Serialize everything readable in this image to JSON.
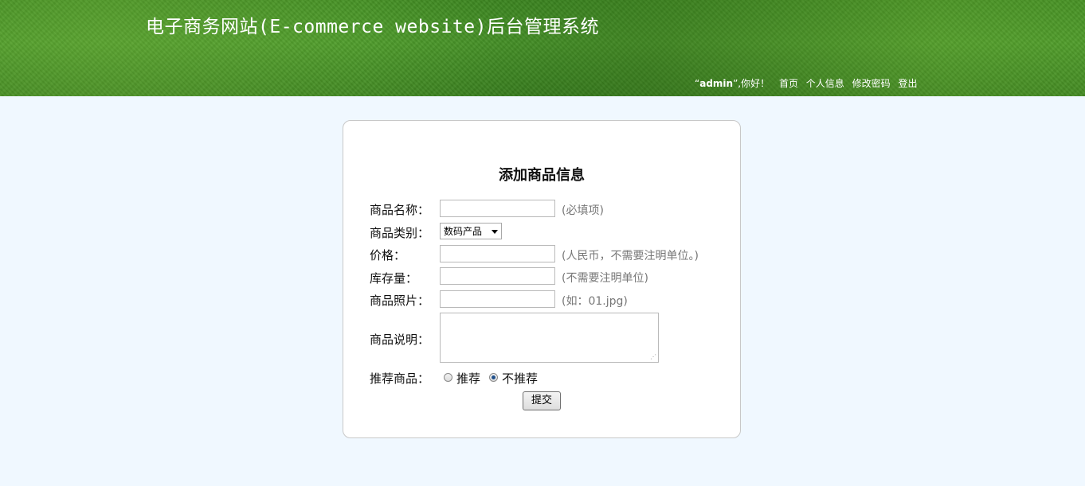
{
  "header": {
    "title": "电子商务网站(E-commerce website)后台管理系统",
    "user_prefix": "“",
    "user": "admin",
    "user_suffix": "”,你好！",
    "links": [
      "首页",
      "个人信息",
      "修改密码",
      "登出"
    ]
  },
  "form": {
    "title": "添加商品信息",
    "fields": {
      "name": {
        "label": "商品名称：",
        "value": "",
        "hint": "(必填项)"
      },
      "category": {
        "label": "商品类别：",
        "selected": "数码产品"
      },
      "price": {
        "label": "价格：",
        "value": "",
        "hint": "(人民币，不需要注明单位。)"
      },
      "stock": {
        "label": "库存量：",
        "value": "",
        "hint": "(不需要注明单位)"
      },
      "photo": {
        "label": "商品照片：",
        "value": "",
        "hint": "(如：01.jpg)"
      },
      "description": {
        "label": "商品说明：",
        "value": ""
      },
      "recommend": {
        "label": "推荐商品：",
        "options": [
          "推荐",
          "不推荐"
        ],
        "selected": "不推荐"
      }
    },
    "submit_label": "提交"
  },
  "colors": {
    "header_green": "#4a9a2a",
    "page_background": "#f0f8ff",
    "hint_gray": "#777777"
  }
}
